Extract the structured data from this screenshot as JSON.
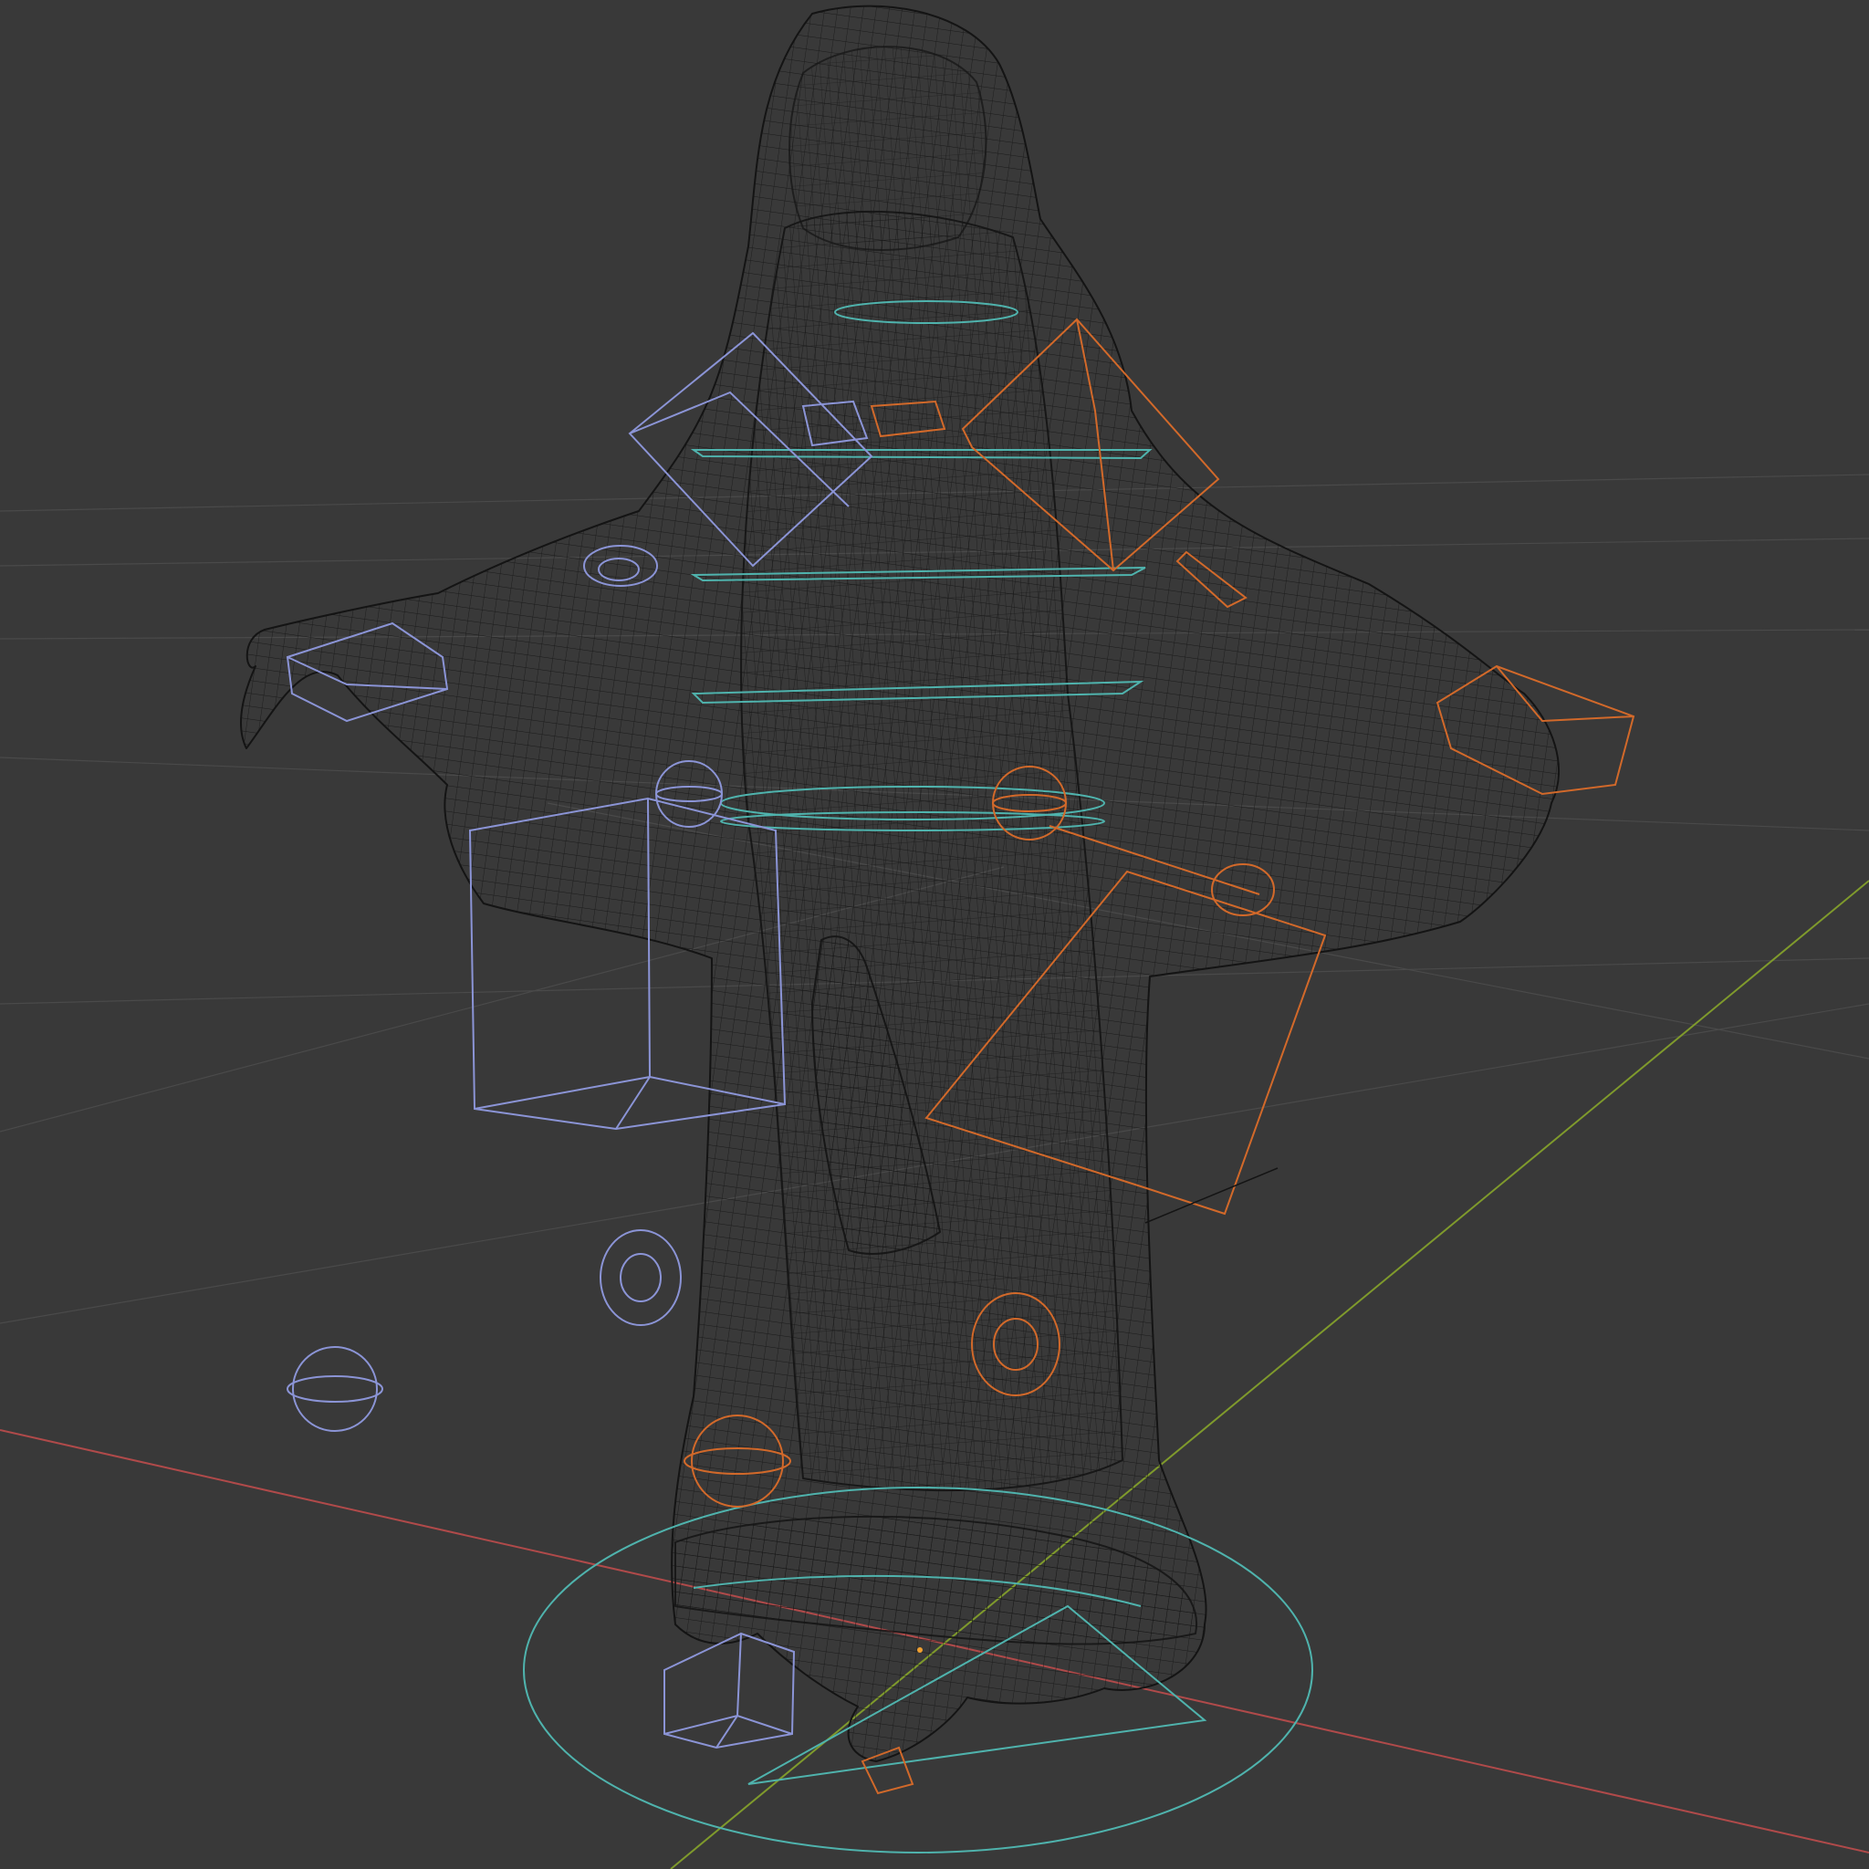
{
  "viewport": {
    "mode": "wireframe",
    "colors": {
      "background": "#393939",
      "grid": "#4a4a4a",
      "x_axis": "#b04a4a",
      "y_axis": "#7f9a2c",
      "mesh_wire": "#141414",
      "control_selected_left": "#8b94d6",
      "control_right": "#d2692a",
      "control_center": "#4fb3ad",
      "origin_dot": "#f0a030"
    }
  },
  "scene_objects": [
    {
      "name": "character-mesh",
      "kind": "mesh",
      "label_visible": false
    },
    {
      "name": "rig-controls-left",
      "kind": "armature-controls",
      "side": "left"
    },
    {
      "name": "rig-controls-right",
      "kind": "armature-controls",
      "side": "right"
    },
    {
      "name": "rig-controls-center",
      "kind": "armature-controls",
      "side": "center"
    },
    {
      "name": "root-control",
      "kind": "root-circle"
    }
  ]
}
